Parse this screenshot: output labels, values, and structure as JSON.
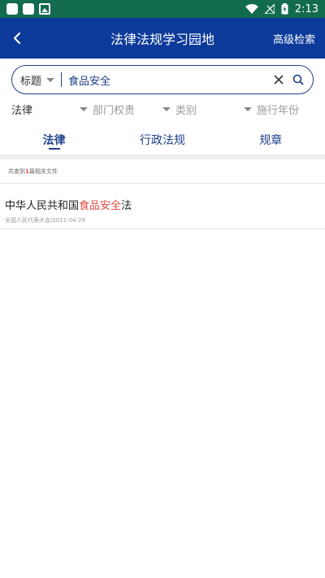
{
  "status_bar": {
    "time": "2:13"
  },
  "header": {
    "title": "法律法规学习园地",
    "advanced_search": "高级检索"
  },
  "search": {
    "field": "标题",
    "value": "食品安全"
  },
  "filters": {
    "category": "法律",
    "department": "部门权责",
    "type": "类别",
    "year": "施行年份"
  },
  "tabs": [
    {
      "label": "法律",
      "active": true
    },
    {
      "label": "行政法规",
      "active": false
    },
    {
      "label": "规章",
      "active": false
    }
  ],
  "results": {
    "count_prefix": "共查到",
    "count": "1",
    "count_suffix": "篇相关文件",
    "items": [
      {
        "title_before": "中华人民共和国",
        "title_highlight": "食品安全",
        "title_after": "法",
        "meta": "全国人民代表大会/2021-04-29"
      }
    ]
  },
  "colors": {
    "header": "#0c3a9a",
    "status_bar": "#136b4f",
    "accent": "#1d3f8a",
    "highlight": "#e04a3f"
  }
}
